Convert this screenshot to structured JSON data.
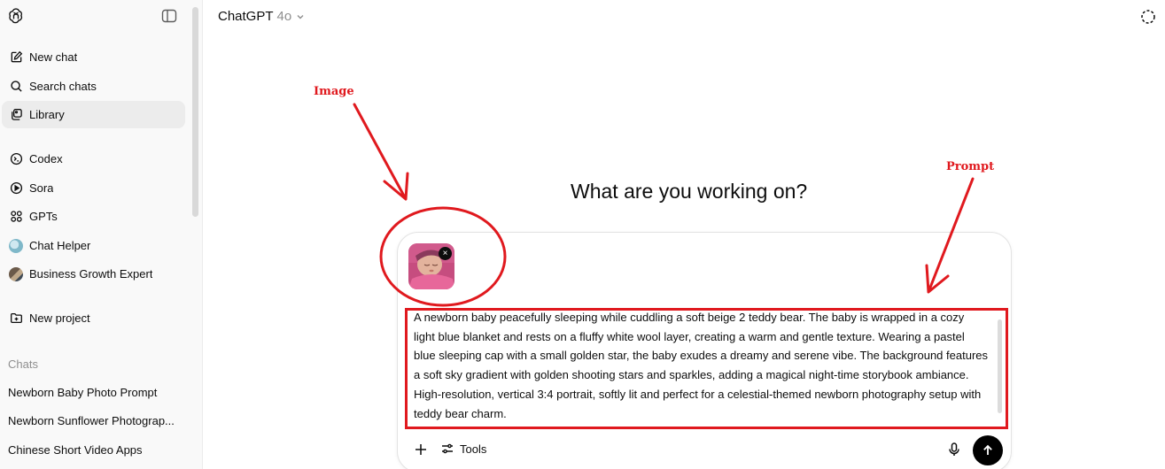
{
  "sidebar": {
    "nav": [
      {
        "label": "New chat",
        "icon": "edit-icon"
      },
      {
        "label": "Search chats",
        "icon": "search-icon"
      },
      {
        "label": "Library",
        "icon": "library-icon"
      }
    ],
    "apps": [
      {
        "label": "Codex",
        "icon": "codex-icon"
      },
      {
        "label": "Sora",
        "icon": "play-circle-icon"
      },
      {
        "label": "GPTs",
        "icon": "grid-icon"
      },
      {
        "label": "Chat Helper",
        "icon": "chat-helper-avatar"
      },
      {
        "label": "Business Growth Expert",
        "icon": "business-growth-avatar"
      }
    ],
    "new_project": "New project",
    "chats_heading": "Chats",
    "chats": [
      "Newborn Baby Photo Prompt",
      "Newborn Sunflower Photograp...",
      "Chinese Short Video Apps"
    ]
  },
  "header": {
    "model_name": "ChatGPT",
    "model_version": "4o"
  },
  "main": {
    "heading": "What are you working on?"
  },
  "composer": {
    "prompt": "A newborn baby peacefully sleeping while cuddling a soft beige 2 teddy bear. The baby is wrapped in a cozy light blue blanket and rests on a fluffy white wool layer, creating a warm and gentle texture. Wearing a pastel blue sleeping cap with a small golden star, the baby exudes a dreamy and serene vibe. The background features a soft sky gradient with golden shooting stars and sparkles, adding a magical night-time storybook ambiance. High-resolution, vertical 3:4 portrait, softly lit and perfect for a celestial-themed newborn photography setup with teddy bear charm.",
    "tools_label": "Tools",
    "attachment_close": "×"
  },
  "annotations": {
    "image_label": "Image",
    "prompt_label": "Prompt",
    "color": "#e0191e"
  }
}
